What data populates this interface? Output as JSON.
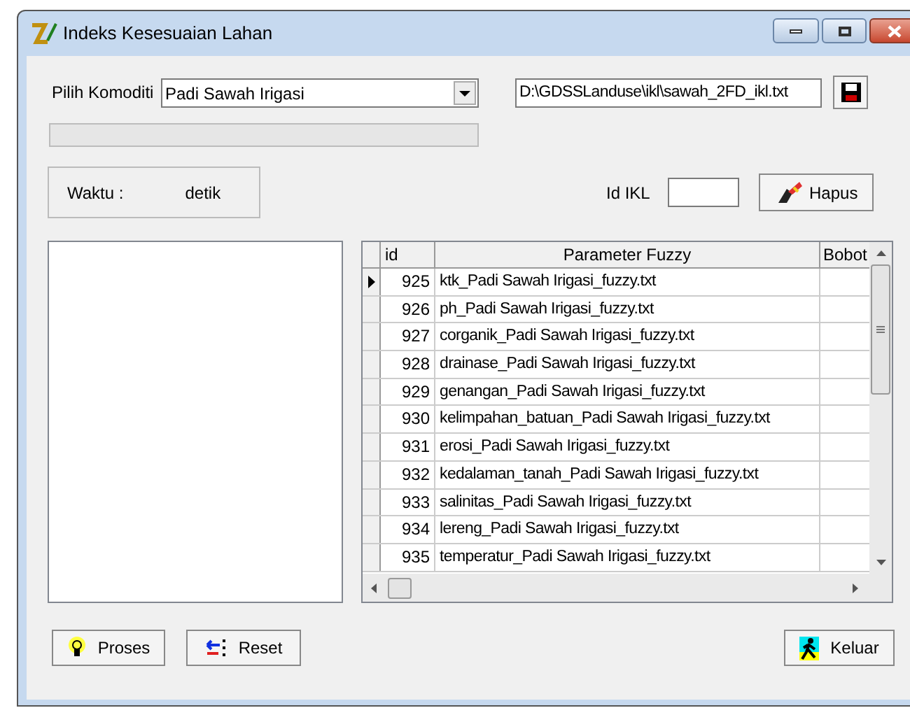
{
  "window": {
    "title": "Indeks Kesesuaian Lahan"
  },
  "komoditi": {
    "label": "Pilih Komoditi",
    "value": "Padi Sawah Irigasi"
  },
  "file_path": {
    "value": "D:\\GDSSLanduse\\ikl\\sawah_2FD_ikl.txt"
  },
  "progress": {
    "level": 0
  },
  "waktu": {
    "label": "Waktu :",
    "unit": "detik"
  },
  "id_ikl": {
    "label": "Id IKL"
  },
  "hapus_button": "Hapus",
  "table": {
    "columns": [
      "id",
      "Parameter Fuzzy",
      "Bobot"
    ],
    "rows": [
      {
        "id": "925",
        "parameter": "ktk_Padi Sawah Irigasi_fuzzy.txt",
        "selected": true
      },
      {
        "id": "926",
        "parameter": "ph_Padi Sawah Irigasi_fuzzy.txt",
        "selected": false
      },
      {
        "id": "927",
        "parameter": "corganik_Padi Sawah Irigasi_fuzzy.txt",
        "selected": false
      },
      {
        "id": "928",
        "parameter": "drainase_Padi Sawah Irigasi_fuzzy.txt",
        "selected": false
      },
      {
        "id": "929",
        "parameter": "genangan_Padi Sawah Irigasi_fuzzy.txt",
        "selected": false
      },
      {
        "id": "930",
        "parameter": "kelimpahan_batuan_Padi Sawah Irigasi_fuzzy.txt",
        "selected": false
      },
      {
        "id": "931",
        "parameter": "erosi_Padi Sawah Irigasi_fuzzy.txt",
        "selected": false
      },
      {
        "id": "932",
        "parameter": "kedalaman_tanah_Padi Sawah Irigasi_fuzzy.txt",
        "selected": false
      },
      {
        "id": "933",
        "parameter": "salinitas_Padi Sawah Irigasi_fuzzy.txt",
        "selected": false
      },
      {
        "id": "934",
        "parameter": "lereng_Padi Sawah Irigasi_fuzzy.txt",
        "selected": false
      },
      {
        "id": "935",
        "parameter": "temperatur_Padi Sawah Irigasi_fuzzy.txt",
        "selected": false
      }
    ]
  },
  "buttons": [
    {
      "kind": "proses",
      "label": "Proses"
    },
    {
      "kind": "reset",
      "label": "Reset"
    },
    {
      "kind": "keluar",
      "label": "Keluar"
    }
  ]
}
